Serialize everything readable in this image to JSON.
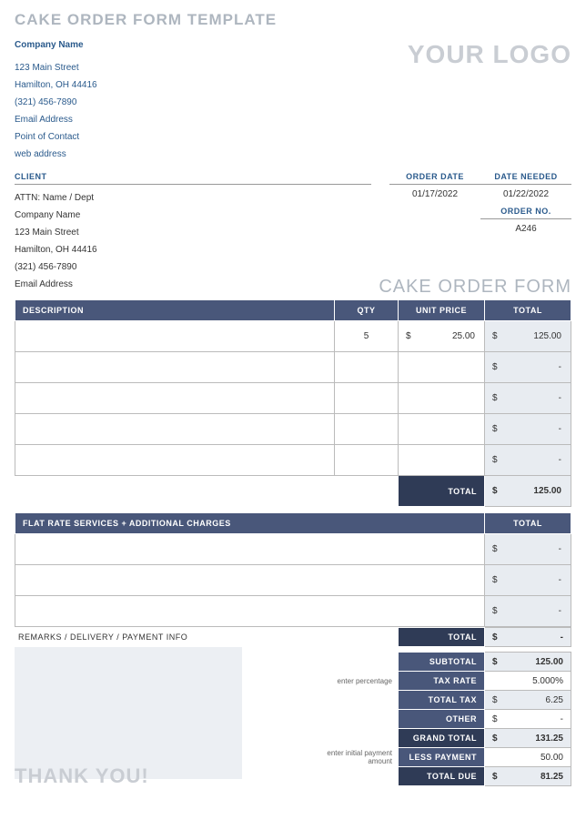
{
  "title": "CAKE ORDER FORM TEMPLATE",
  "logo": "YOUR LOGO",
  "form_title": "CAKE ORDER FORM",
  "company": {
    "name": "Company Name",
    "street": "123 Main Street",
    "city": "Hamilton, OH 44416",
    "phone": "(321) 456-7890",
    "email": "Email Address",
    "contact": "Point of Contact",
    "web": "web address"
  },
  "client": {
    "header": "CLIENT",
    "attn": "ATTN: Name / Dept",
    "company": "Company Name",
    "street": "123 Main Street",
    "city": "Hamilton, OH 44416",
    "phone": "(321) 456-7890",
    "email": "Email Address"
  },
  "meta": {
    "order_date_label": "ORDER DATE",
    "date_needed_label": "DATE NEEDED",
    "order_no_label": "ORDER NO.",
    "order_date": "01/17/2022",
    "date_needed": "01/22/2022",
    "order_no": "A246"
  },
  "items_header": {
    "desc": "DESCRIPTION",
    "qty": "QTY",
    "price": "UNIT PRICE",
    "total": "TOTAL"
  },
  "items": [
    {
      "desc": "",
      "qty": "5",
      "price": "25.00",
      "total": "125.00"
    },
    {
      "desc": "",
      "qty": "",
      "price": "",
      "total": "-"
    },
    {
      "desc": "",
      "qty": "",
      "price": "",
      "total": "-"
    },
    {
      "desc": "",
      "qty": "",
      "price": "",
      "total": "-"
    },
    {
      "desc": "",
      "qty": "",
      "price": "",
      "total": "-"
    }
  ],
  "items_total_label": "TOTAL",
  "items_total": "125.00",
  "services_header": "FLAT RATE SERVICES + ADDITIONAL CHARGES",
  "services_total_header": "TOTAL",
  "services": [
    {
      "desc": "",
      "total": "-"
    },
    {
      "desc": "",
      "total": "-"
    },
    {
      "desc": "",
      "total": "-"
    }
  ],
  "services_total_label": "TOTAL",
  "services_total": "-",
  "remarks_header": "REMARKS / DELIVERY / PAYMENT INFO",
  "hints": {
    "percentage": "enter percentage",
    "payment": "enter initial payment amount"
  },
  "summary": {
    "subtotal_label": "SUBTOTAL",
    "subtotal": "125.00",
    "tax_rate_label": "TAX RATE",
    "tax_rate": "5.000%",
    "total_tax_label": "TOTAL TAX",
    "total_tax": "6.25",
    "other_label": "OTHER",
    "other": "-",
    "grand_total_label": "GRAND TOTAL",
    "grand_total": "131.25",
    "less_payment_label": "LESS PAYMENT",
    "less_payment": "50.00",
    "total_due_label": "TOTAL DUE",
    "total_due": "81.25"
  },
  "currency": "$",
  "thanks": "THANK YOU!"
}
